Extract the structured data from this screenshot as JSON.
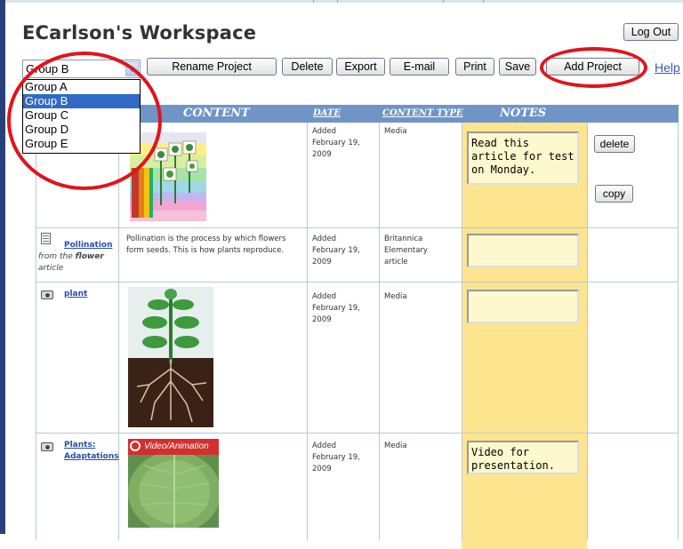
{
  "workspace": {
    "title": "ECarlson's Workspace"
  },
  "toolbar": {
    "logout_label": "Log Out",
    "rename_label": "Rename Project",
    "delete_label": "Delete",
    "export_label": "Export",
    "email_label": "E-mail",
    "print_label": "Print",
    "save_label": "Save",
    "add_project_label": "Add Project",
    "help_label": "Help"
  },
  "project_select": {
    "selected": "Group B",
    "options": [
      "Group A",
      "Group B",
      "Group C",
      "Group D",
      "Group E"
    ]
  },
  "table": {
    "headers": {
      "content": "CONTENT",
      "date": "DATE",
      "content_type": "CONTENT TYPE",
      "notes": "NOTES"
    },
    "rows": [
      {
        "date_lines": [
          "Added",
          "February 19,",
          "2009"
        ],
        "type_lines": [
          "Media"
        ],
        "note": "Read this article for test on Monday.",
        "delete_label": "delete",
        "copy_label": "copy"
      },
      {
        "title": "Pollination",
        "source_prefix": "from the",
        "source_name": "flower",
        "source_suffix": "article",
        "description": "Pollination is the process by which flowers form seeds. This is how plants reproduce.",
        "date_lines": [
          "Added",
          "February 19,",
          "2009"
        ],
        "type_lines": [
          "Britannica",
          "Elementary",
          "article"
        ],
        "note": ""
      },
      {
        "title": "plant",
        "date_lines": [
          "Added",
          "February 19,",
          "2009"
        ],
        "type_lines": [
          "Media"
        ],
        "note": ""
      },
      {
        "title_lines": [
          "Plants:",
          "Adaptations"
        ],
        "badge": "Video/Animation",
        "date_lines": [
          "Added",
          "February 19,",
          "2009"
        ],
        "type_lines": [
          "Media"
        ],
        "note": "Video for presentation."
      }
    ]
  },
  "colors": {
    "header_blue": "#6e95c6",
    "notes_yellow": "#fde58f",
    "annotation_red": "#e0141c",
    "link_blue": "#2a4da8",
    "select_highlight": "#316ac5"
  },
  "icons": {
    "media": "camera-icon",
    "article": "document-icon",
    "select_arrow": "chevron-down-icon"
  }
}
